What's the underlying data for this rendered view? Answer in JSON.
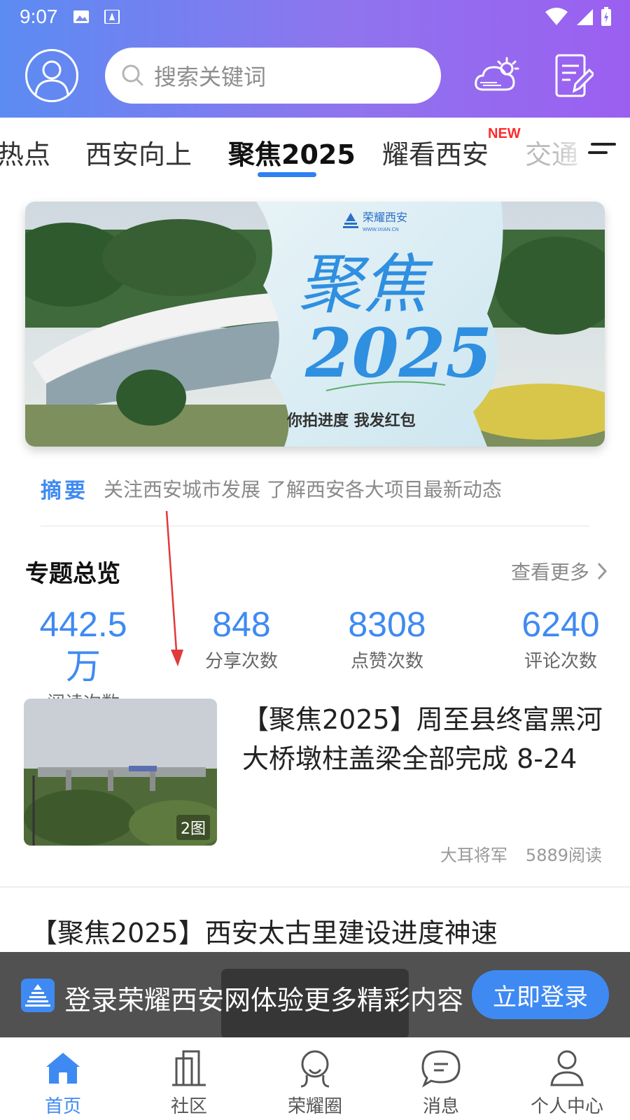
{
  "status": {
    "time": "9:07"
  },
  "search": {
    "placeholder": "搜索关键词"
  },
  "tabs": {
    "items": [
      "热点",
      "西安向上",
      "聚焦2025",
      "耀看西安",
      "交通"
    ],
    "active": "聚焦2025",
    "badge": "NEW"
  },
  "banner": {
    "brand": "荣耀西安",
    "brand_url": "WWW.IXIAN.CN",
    "headline_top": "聚焦",
    "headline_bottom": "2025",
    "caption": "你拍进度 我发红包"
  },
  "summary": {
    "label": "摘要",
    "text": "关注西安城市发展 了解西安各大项目最新动态"
  },
  "overview": {
    "title": "专题总览",
    "more": "查看更多",
    "stats": [
      {
        "value": "442.5万",
        "label": "阅读次数"
      },
      {
        "value": "848",
        "label": "分享次数"
      },
      {
        "value": "8308",
        "label": "点赞次数"
      },
      {
        "value": "6240",
        "label": "评论次数"
      }
    ]
  },
  "articles": [
    {
      "title": "【聚焦2025】周至县终富黑河大桥墩柱盖梁全部完成 8-24",
      "images": "2图",
      "author": "大耳将军",
      "reads": "5889阅读"
    },
    {
      "title": "【聚焦2025】西安太古里建设进度神速"
    }
  ],
  "login_bar": {
    "text": "登录荣耀西安网体验更多精彩内容",
    "button": "立即登录"
  },
  "bottom_nav": [
    {
      "label": "首页",
      "icon": "home-icon"
    },
    {
      "label": "社区",
      "icon": "buildings-icon"
    },
    {
      "label": "荣耀圈",
      "icon": "circle-people-icon"
    },
    {
      "label": "消息",
      "icon": "message-icon"
    },
    {
      "label": "个人中心",
      "icon": "person-icon"
    }
  ],
  "colors": {
    "accent": "#3f8af2",
    "badge_red": "#ff2a2a",
    "header_start": "#5b8cf2",
    "header_end": "#9b5ff0"
  }
}
